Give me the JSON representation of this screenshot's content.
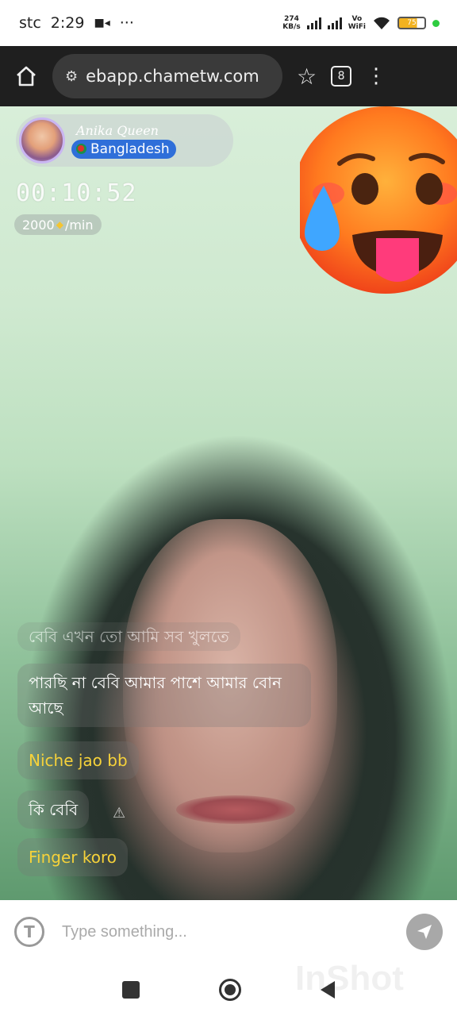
{
  "status_bar": {
    "carrier": "stc",
    "time": "2:29",
    "more": "···",
    "net_speed_value": "274",
    "net_speed_unit": "KB/s",
    "vowifi_top": "Vo",
    "vowifi_bottom": "WiFi",
    "battery": "75"
  },
  "browser": {
    "url": "ebapp.chametw.com",
    "tab_count": "8"
  },
  "profile": {
    "name": "Anika Queen",
    "country": "Bangladesh"
  },
  "call": {
    "timer": "00:10:52",
    "rate_value": "2000",
    "rate_unit": "/min"
  },
  "chat": {
    "messages": [
      {
        "text": "বেবি এখন তো আমি সব খুলতে"
      },
      {
        "text": "পারছি না বেবি আমার পাশে আমার বোন আছে"
      },
      {
        "text": "Niche jao bb"
      },
      {
        "text": "কি বেবি"
      },
      {
        "text": "Finger koro"
      }
    ]
  },
  "input": {
    "placeholder": "Type something..."
  },
  "watermark": "InShot"
}
